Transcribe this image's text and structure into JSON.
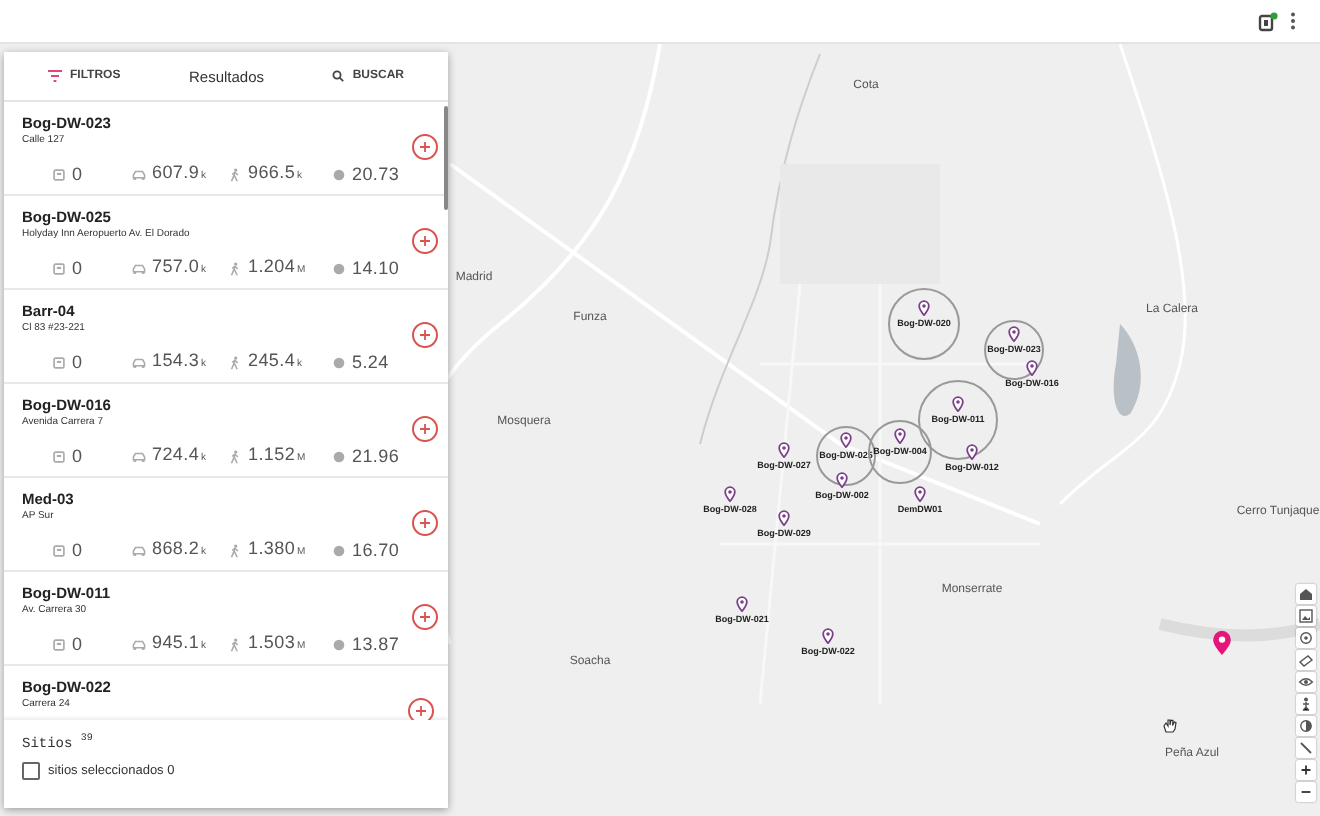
{
  "panel": {
    "header": {
      "filter_label": "FILTROS",
      "title": "Resultados",
      "search_label": "BUSCAR"
    },
    "results": [
      {
        "name": "Bog-DW-023",
        "address": "Calle 127",
        "stats": [
          {
            "value": "0"
          },
          {
            "value": "607.9",
            "unit": "k"
          },
          {
            "value": "966.5",
            "unit": "k"
          },
          {
            "value": "20.73"
          }
        ]
      },
      {
        "name": "Bog-DW-025",
        "address": "Holyday Inn Aeropuerto Av. El Dorado",
        "stats": [
          {
            "value": "0"
          },
          {
            "value": "757.0",
            "unit": "k"
          },
          {
            "value": "1.204",
            "unit": "M"
          },
          {
            "value": "14.10"
          }
        ]
      },
      {
        "name": "Barr-04",
        "address": "Cl 83 #23-221",
        "stats": [
          {
            "value": "0"
          },
          {
            "value": "154.3",
            "unit": "k"
          },
          {
            "value": "245.4",
            "unit": "k"
          },
          {
            "value": "5.24"
          }
        ]
      },
      {
        "name": "Bog-DW-016",
        "address": "Avenida Carrera 7",
        "stats": [
          {
            "value": "0"
          },
          {
            "value": "724.4",
            "unit": "k"
          },
          {
            "value": "1.152",
            "unit": "M"
          },
          {
            "value": "21.96"
          }
        ]
      },
      {
        "name": "Med-03",
        "address": "AP Sur",
        "stats": [
          {
            "value": "0"
          },
          {
            "value": "868.2",
            "unit": "k"
          },
          {
            "value": "1.380",
            "unit": "M"
          },
          {
            "value": "16.70"
          }
        ]
      },
      {
        "name": "Bog-DW-011",
        "address": "Av. Carrera 30",
        "stats": [
          {
            "value": "0"
          },
          {
            "value": "945.1",
            "unit": "k"
          },
          {
            "value": "1.503",
            "unit": "M"
          },
          {
            "value": "13.87"
          }
        ]
      },
      {
        "name": "Bog-DW-022",
        "address": "Carrera 24"
      }
    ],
    "footer": {
      "sites_label": "Sitios $^{39}$",
      "select_all": {
        "label": "sitios seleccionados 0",
        "checked": false
      }
    }
  },
  "map": {
    "places": [
      "Cota",
      "Madrid",
      "Funza",
      "Mosquera",
      "Soacha",
      "La Calera",
      "Monserrate",
      "Cerro Tunjaque",
      "Peña Azul"
    ],
    "markers": [
      {
        "name": "Bog-DW-020",
        "coverage": true
      },
      {
        "name": "Bog-DW-023",
        "coverage": true
      },
      {
        "name": "Bog-DW-016",
        "coverage": false
      },
      {
        "name": "Bog-DW-011",
        "coverage": true
      },
      {
        "name": "Bog-DW-025",
        "coverage": true
      },
      {
        "name": "Bog-DW-004",
        "coverage": true
      },
      {
        "name": "Bog-DW-012",
        "coverage": false
      },
      {
        "name": "Bog-DW-027",
        "coverage": false
      },
      {
        "name": "Bog-DW-002",
        "coverage": false
      },
      {
        "name": "Bog-DW-028",
        "coverage": false
      },
      {
        "name": "DemDW01",
        "coverage": false
      },
      {
        "name": "Bog-DW-029",
        "coverage": false
      },
      {
        "name": "Bog-DW-021",
        "coverage": false
      },
      {
        "name": "Bog-DW-022",
        "coverage": false
      }
    ]
  }
}
